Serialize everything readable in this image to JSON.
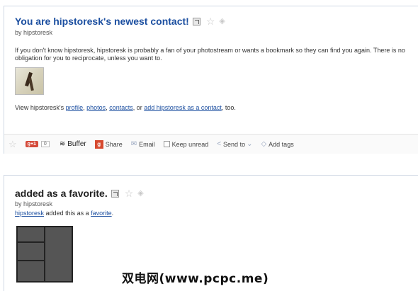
{
  "card1": {
    "title": "You are hipstoresk's newest contact!",
    "by_line": "by hipstoresk",
    "description": "If you don't know hipstoresk, hipstoresk is probably a fan of your photostream or wants a bookmark so they can find you again. There is no obligation for you to reciprocate, unless you want to.",
    "view_prefix": "View hipstoresk's",
    "links": [
      "profile",
      "photos",
      "contacts"
    ],
    "separator1": ",",
    "separator2": ", or",
    "add_contact": "add hipstoresk as a contact",
    "view_suffix": ", too."
  },
  "action_bar": {
    "gplus_label": "+1",
    "gplus_count": "0",
    "buffer": "Buffer",
    "share": "Share",
    "email": "Email",
    "keep_unread": "Keep unread",
    "send_to": "Send to",
    "add_tags": "Add tags"
  },
  "card2": {
    "title": "added as a favorite.",
    "by_line": "by hipstoresk",
    "fav_user": "hipstoresk",
    "fav_mid": "added this as a",
    "fav_word": "favorite",
    "fav_end": "."
  },
  "watermark": "双电网(www.pcpc.me)"
}
